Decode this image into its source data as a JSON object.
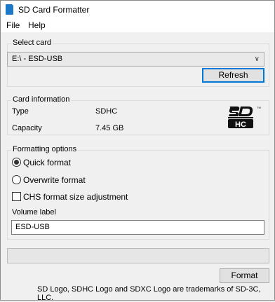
{
  "window": {
    "title": "SD Card Formatter"
  },
  "menu": {
    "file": "File",
    "help": "Help"
  },
  "select_card": {
    "legend": "Select card",
    "selected": "E:\\ - ESD-USB",
    "refresh_label": "Refresh"
  },
  "card_info": {
    "legend": "Card information",
    "type_label": "Type",
    "type_value": "SDHC",
    "capacity_label": "Capacity",
    "capacity_value": "7.45 GB",
    "logo_text": "SD HC"
  },
  "formatting": {
    "legend": "Formatting options",
    "quick_label": "Quick format",
    "quick_checked": true,
    "overwrite_label": "Overwrite format",
    "overwrite_checked": false,
    "chs_label": "CHS format size adjustment",
    "chs_checked": false,
    "volume_label_caption": "Volume label",
    "volume_label_value": "ESD-USB"
  },
  "progress": {
    "value": 0
  },
  "actions": {
    "format_label": "Format"
  },
  "footer": {
    "text": "SD Logo, SDHC Logo and SDXC Logo are trademarks of SD-3C, LLC."
  }
}
